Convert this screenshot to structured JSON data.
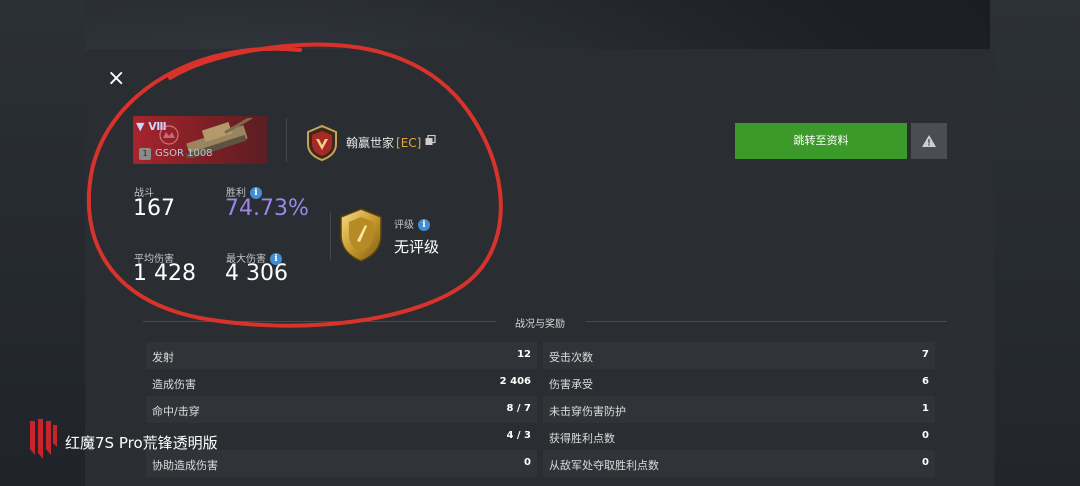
{
  "vehicle": {
    "tier": "Ⅷ",
    "name": "GSOR 1008",
    "level": "1"
  },
  "player": {
    "name": "翰赢世家",
    "clan_tag": "[EC]"
  },
  "stats": {
    "battles_label": "战斗",
    "battles_value": "167",
    "winrate_label": "胜利",
    "winrate_value": "74.73%",
    "avg_damage_label": "平均伤害",
    "avg_damage_value": "1 428",
    "max_damage_label": "最大伤害",
    "max_damage_value": "4 306",
    "rating_label": "评级",
    "rating_value": "无评级"
  },
  "buttons": {
    "goto_profile": "跳转至资料"
  },
  "section": {
    "title": "战况与奖励"
  },
  "left_rows": [
    {
      "label": "发射",
      "value": "12"
    },
    {
      "label": "造成伤害",
      "value": "2 406"
    },
    {
      "label": "命中/击穿",
      "value": "8 / 7"
    },
    {
      "label": "",
      "value": "4 / 3"
    },
    {
      "label": "协助造成伤害",
      "value": "0"
    }
  ],
  "right_rows": [
    {
      "label": "受击次数",
      "value": "7"
    },
    {
      "label": "伤害承受",
      "value": "6"
    },
    {
      "label": "未击穿伤害防护",
      "value": "1"
    },
    {
      "label": "获得胜利点数",
      "value": "0"
    },
    {
      "label": "从敌军处夺取胜利点数",
      "value": "0"
    }
  ],
  "watermark": {
    "text": "红魔7S Pro荒锋透明版"
  },
  "colors": {
    "accent_green": "#3c9a2a",
    "winrate_purple": "#9c86e8",
    "annotation_red": "#d8332b",
    "clan_tag": "#e6a53a"
  },
  "icons": [
    "close-icon",
    "copy-icon",
    "info-icon",
    "warning-icon",
    "clan-badge-icon",
    "rating-badge-icon",
    "redmagic-logo-icon"
  ]
}
